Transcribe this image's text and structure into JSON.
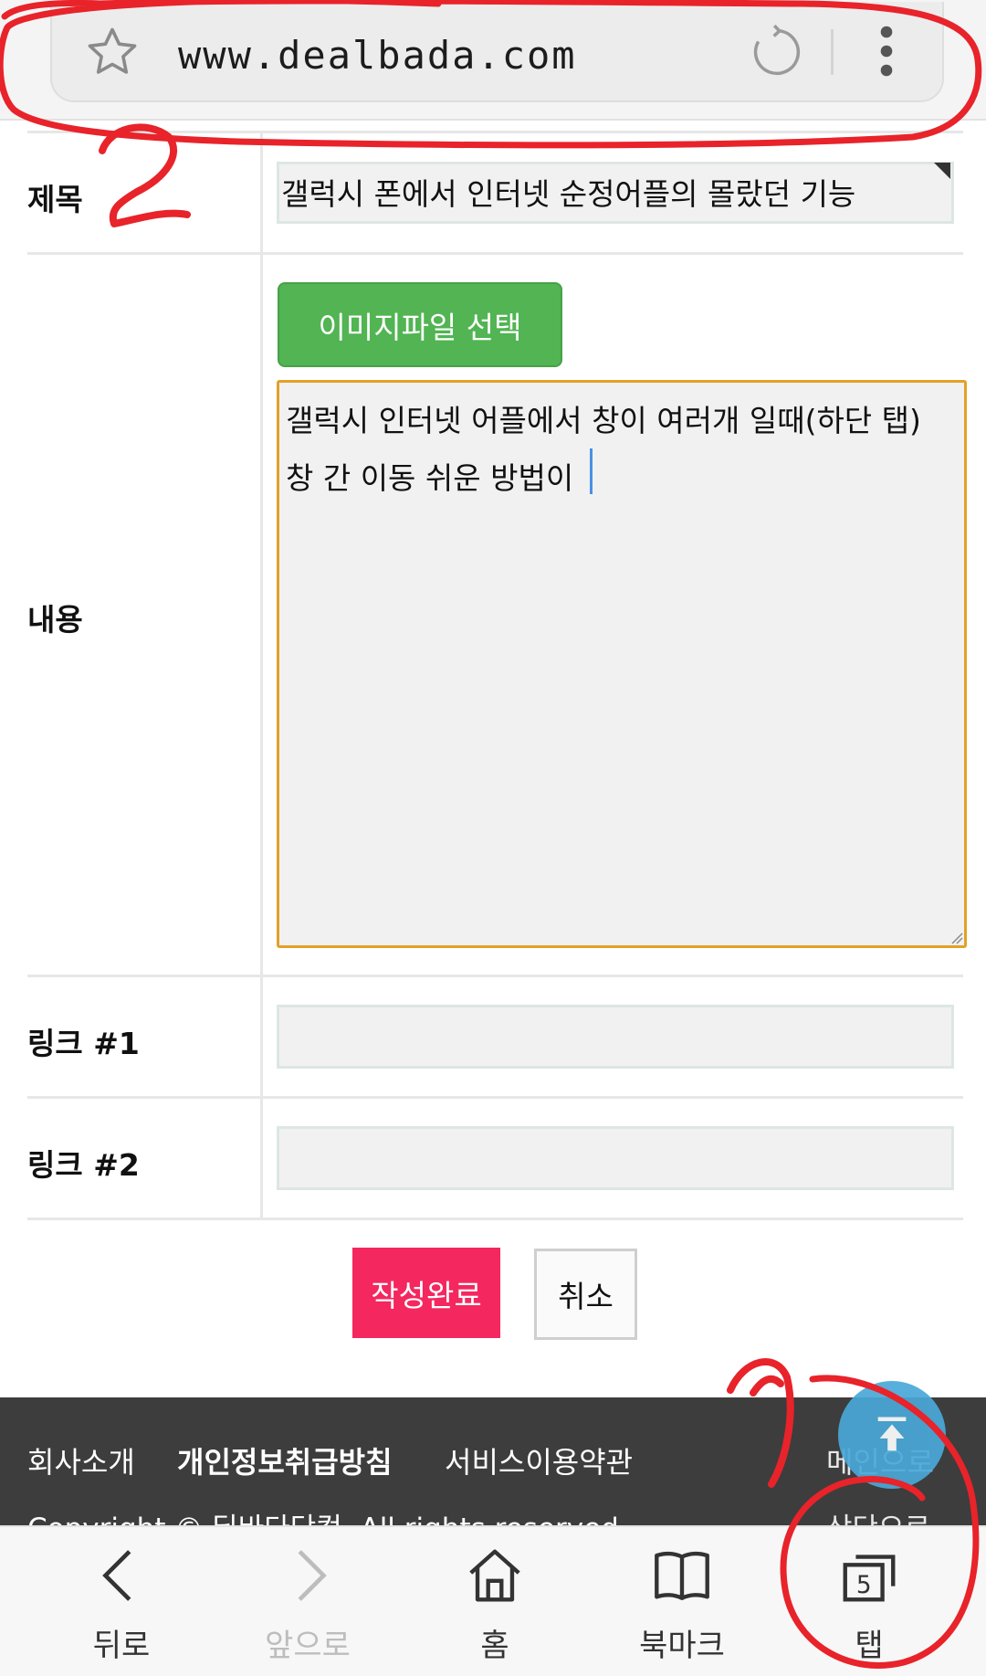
{
  "browser": {
    "url": "www.dealbada.com",
    "icons": [
      "star-icon",
      "reload-icon",
      "more-vert-icon"
    ]
  },
  "form": {
    "title_label": "제목",
    "title_value": "갤럭시 폰에서 인터넷 순정어플의 몰랐던 기능",
    "content_label": "내용",
    "image_button": "이미지파일 선택",
    "content_lines": [
      "갤럭시 인터넷 어플에서 창이 여러개 일때(하단 탭)",
      "창 간 이동 쉬운 방법이"
    ],
    "link1_label": "링크 #1",
    "link1_value": "",
    "link2_label": "링크 #2",
    "link2_value": "",
    "submit_button": "작성완료",
    "cancel_button": "취소"
  },
  "footer": {
    "links": [
      "회사소개",
      "개인정보취급방침",
      "서비스이용약관"
    ],
    "copyright": "Copyright © 딜바다닷컴. All rights reserved.",
    "main_link": "메인으로",
    "side_link": "상단으로"
  },
  "bottom_nav": {
    "items": [
      {
        "label": "뒤로",
        "icon": "chevron-left-icon",
        "enabled": true
      },
      {
        "label": "앞으로",
        "icon": "chevron-right-icon",
        "enabled": false
      },
      {
        "label": "홈",
        "icon": "home-icon",
        "enabled": true
      },
      {
        "label": "북마크",
        "icon": "bookmark-icon",
        "enabled": true
      },
      {
        "label": "탭",
        "icon": "tabs-icon",
        "enabled": true
      }
    ],
    "tab_count": "5"
  },
  "annotations": [
    "1",
    "2"
  ],
  "colors": {
    "green_button": "#52b453",
    "submit_button": "#f4275f",
    "textarea_border": "#e3a128",
    "annotation_red": "#e8232a",
    "fab": "#4aa8d8"
  }
}
